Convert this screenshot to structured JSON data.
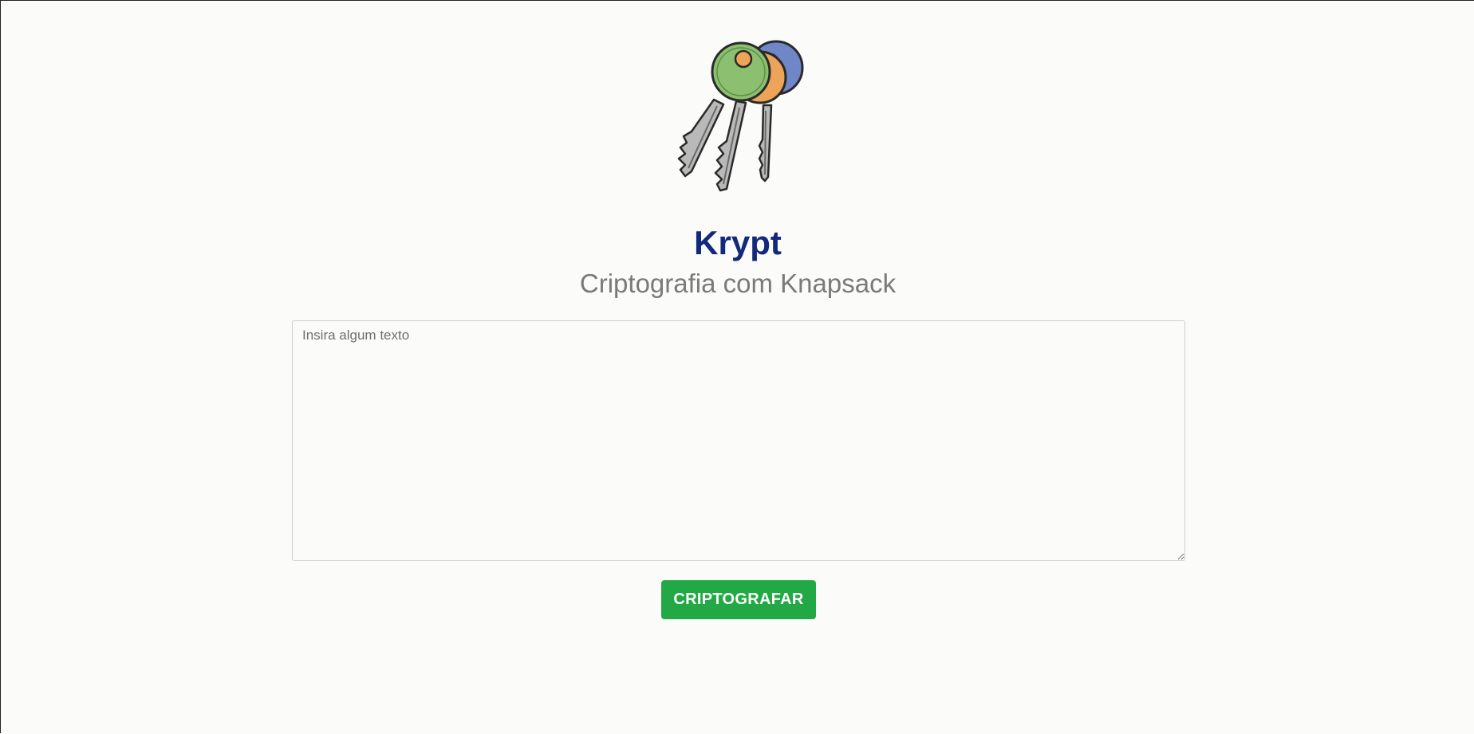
{
  "header": {
    "logo_icon": "keys-icon",
    "title": "Krypt",
    "subtitle": "Criptografia com Knapsack"
  },
  "form": {
    "input_value": "",
    "input_placeholder": "Insira algum texto",
    "submit_label": "CRIPTOGRAFAR"
  },
  "colors": {
    "title": "#13297a",
    "subtitle": "#7a7a7a",
    "button": "#22a844",
    "key_green": "#8cc070",
    "key_orange": "#eda459",
    "key_blue": "#6f86c7"
  }
}
